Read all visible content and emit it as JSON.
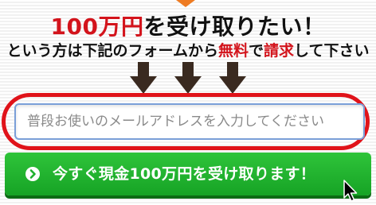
{
  "headline": {
    "accent": "100万円",
    "rest": "を受け取りたい！"
  },
  "subline": {
    "part1": "という方は下記のフォームから",
    "accent1": "無料",
    "part2": "で",
    "accent2": "請求",
    "part3": "して下さい"
  },
  "form": {
    "email_placeholder": "普段お使いのメールアドレスを入力してください",
    "submit_label": "今すぐ現金100万円を受け取ります！"
  },
  "colors": {
    "accent_red": "#d3141c",
    "ring_red": "#e0131a",
    "button_green": "#1fb02d",
    "top_arrow_orange": "#ee7b22",
    "arrow_brown": "#3a2a20"
  },
  "icons": {
    "top_arrow": "orange-down-arrow-icon",
    "down_arrows": [
      "down-arrow-icon",
      "down-arrow-icon",
      "down-arrow-icon"
    ],
    "button_icon": "chevron-right-icon",
    "pointer": "mouse-cursor-icon"
  }
}
